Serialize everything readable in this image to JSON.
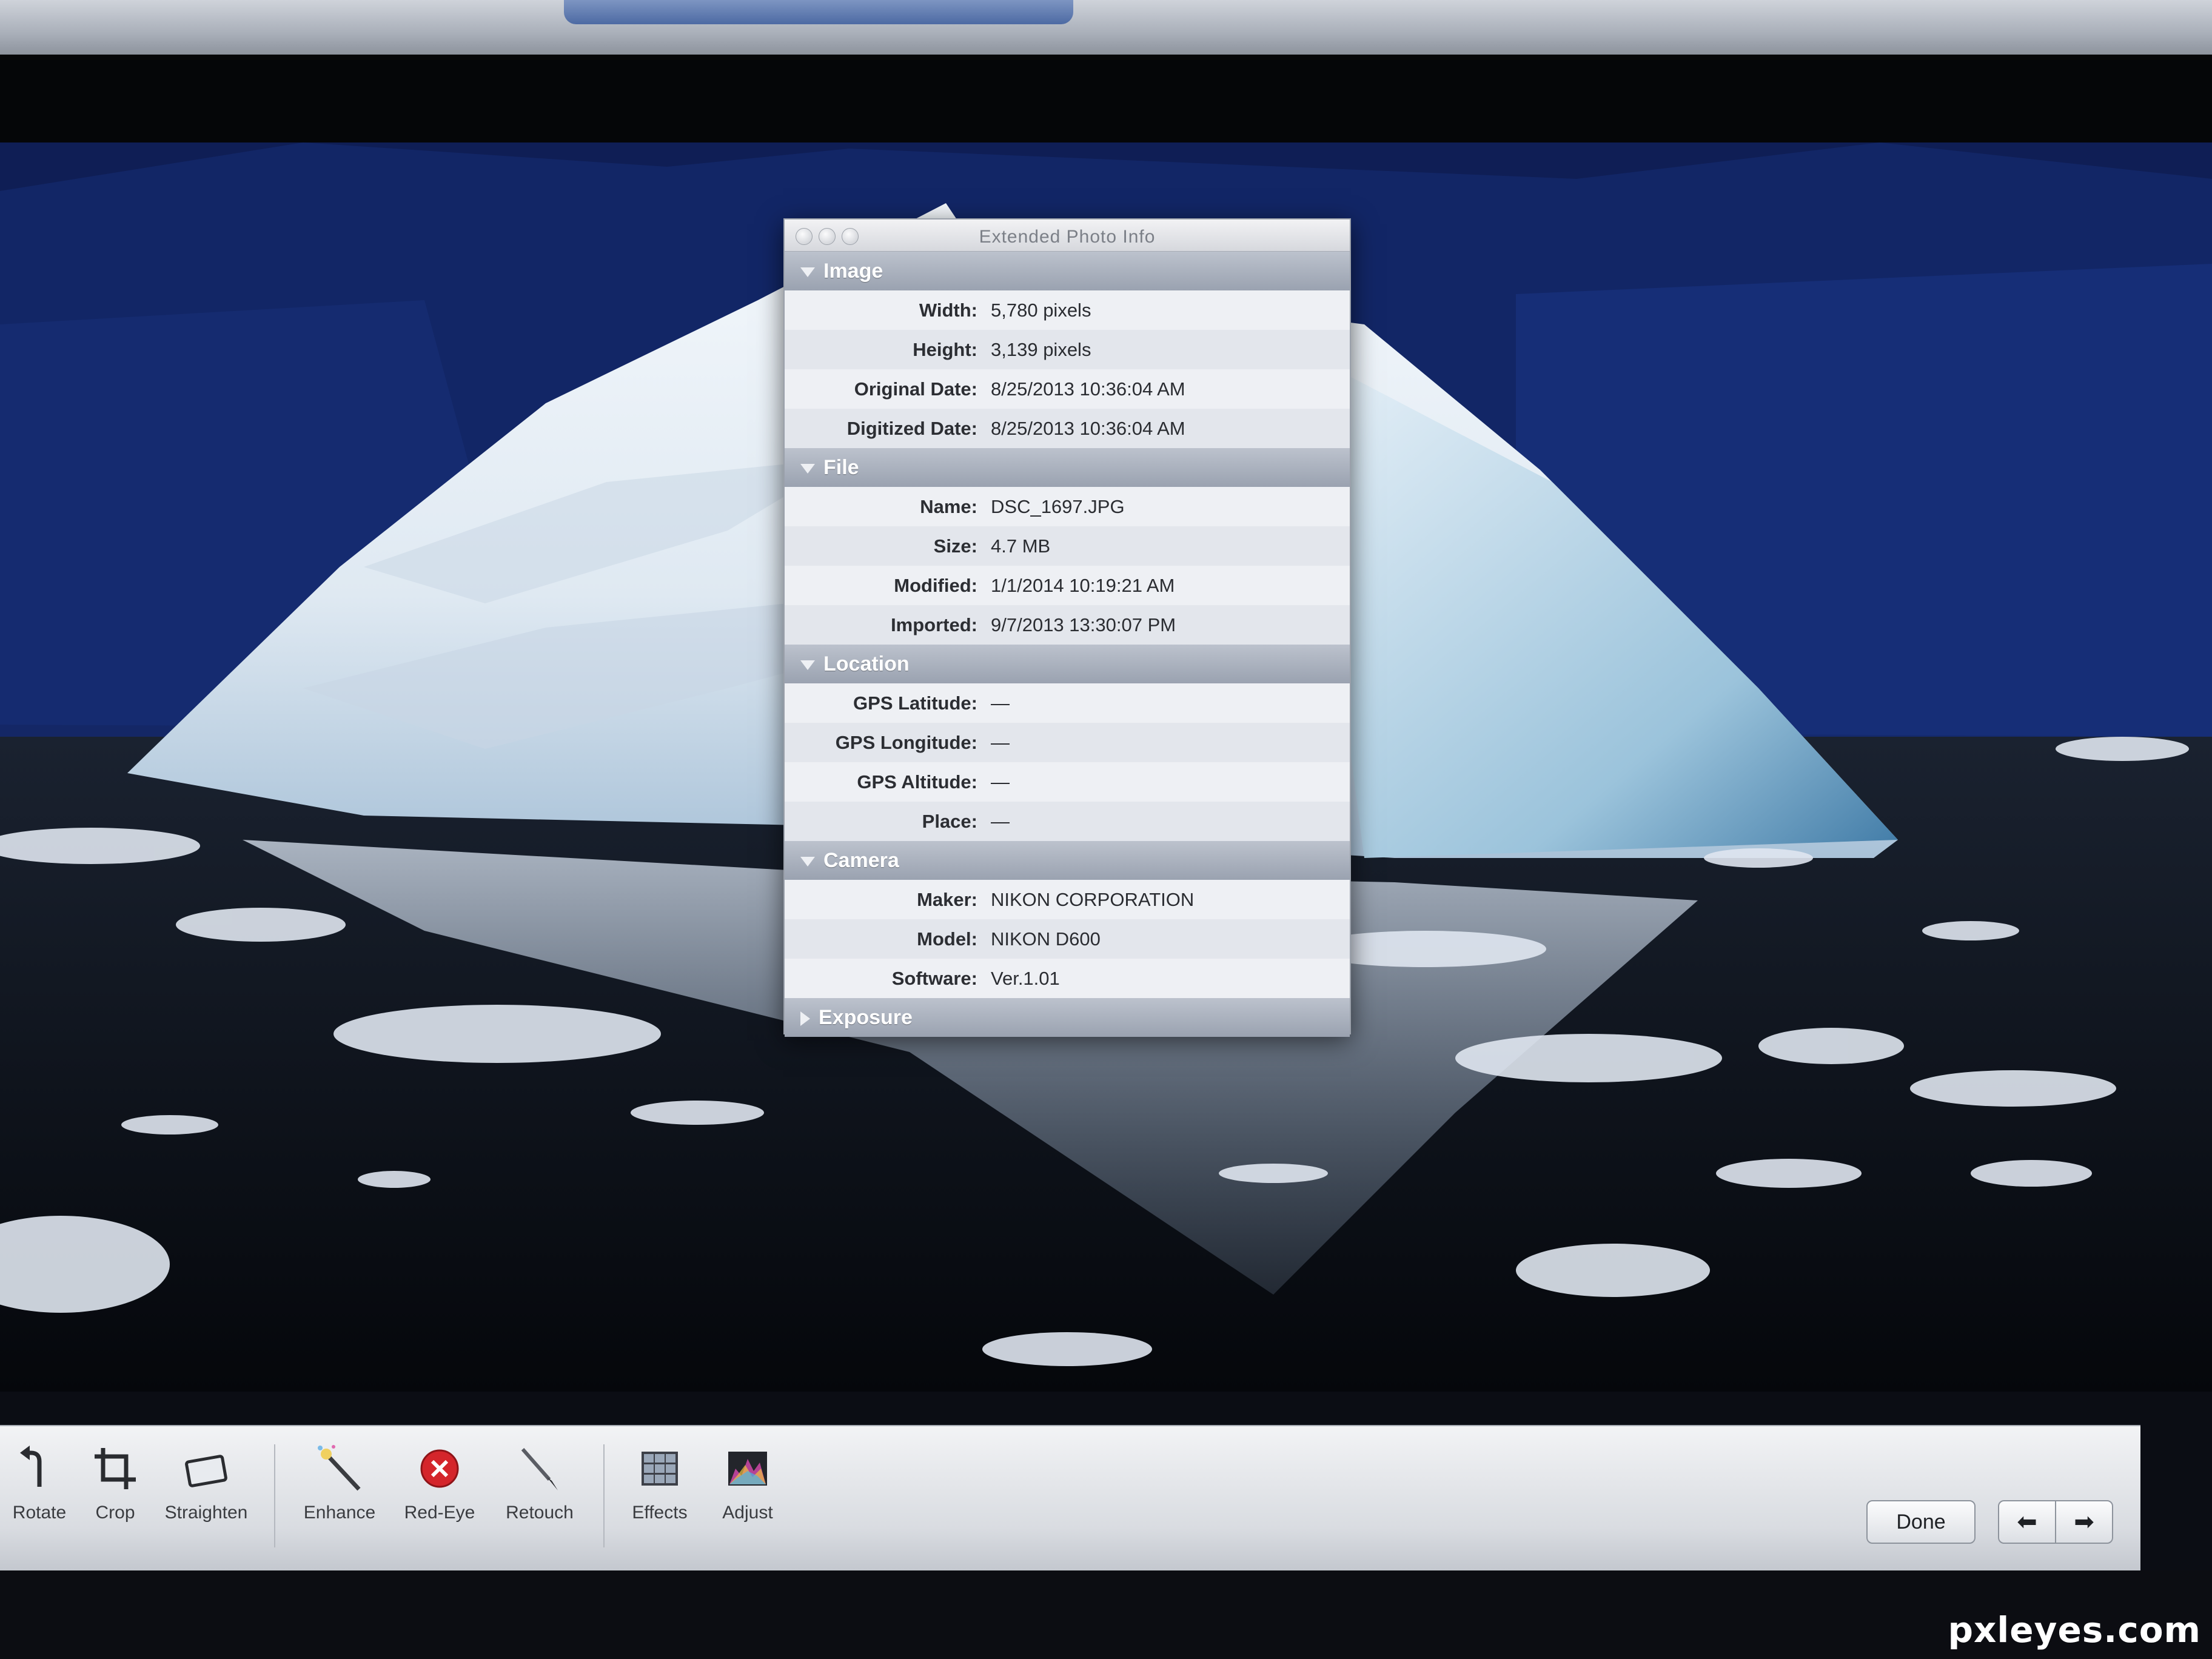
{
  "window": {
    "title": "Extended Photo Info"
  },
  "sections": [
    {
      "title": "Image",
      "expanded": true,
      "rows": [
        {
          "label": "Width:",
          "value": "5,780 pixels"
        },
        {
          "label": "Height:",
          "value": "3,139 pixels"
        },
        {
          "label": "Original Date:",
          "value": "8/25/2013 10:36:04 AM"
        },
        {
          "label": "Digitized Date:",
          "value": "8/25/2013 10:36:04 AM"
        }
      ]
    },
    {
      "title": "File",
      "expanded": true,
      "rows": [
        {
          "label": "Name:",
          "value": "DSC_1697.JPG"
        },
        {
          "label": "Size:",
          "value": "4.7 MB"
        },
        {
          "label": "Modified:",
          "value": "1/1/2014 10:19:21 AM"
        },
        {
          "label": "Imported:",
          "value": "9/7/2013 13:30:07 PM"
        }
      ]
    },
    {
      "title": "Location",
      "expanded": true,
      "rows": [
        {
          "label": "GPS Latitude:",
          "value": "—"
        },
        {
          "label": "GPS Longitude:",
          "value": "—"
        },
        {
          "label": "GPS Altitude:",
          "value": "—"
        },
        {
          "label": "Place:",
          "value": "—"
        }
      ]
    },
    {
      "title": "Camera",
      "expanded": true,
      "rows": [
        {
          "label": "Maker:",
          "value": "NIKON CORPORATION"
        },
        {
          "label": "Model:",
          "value": "NIKON D600"
        },
        {
          "label": "Software:",
          "value": "Ver.1.01"
        }
      ]
    },
    {
      "title": "Exposure",
      "expanded": false,
      "rows": []
    }
  ],
  "toolbar": {
    "tools": [
      {
        "label": "Rotate",
        "icon": "rotate-icon"
      },
      {
        "label": "Crop",
        "icon": "crop-icon"
      },
      {
        "label": "Straighten",
        "icon": "straighten-icon"
      },
      {
        "label": "Enhance",
        "icon": "magic-wand-icon"
      },
      {
        "label": "Red-Eye",
        "icon": "red-eye-icon"
      },
      {
        "label": "Retouch",
        "icon": "brush-icon"
      },
      {
        "label": "Effects",
        "icon": "effects-grid-icon"
      },
      {
        "label": "Adjust",
        "icon": "histogram-icon"
      }
    ],
    "done_label": "Done",
    "prev_icon": "arrow-left-icon",
    "next_icon": "arrow-right-icon"
  },
  "watermark": "pxleyes.com",
  "colors": {
    "red_eye": "#d4252b",
    "panel_header": "#a3abb9"
  }
}
